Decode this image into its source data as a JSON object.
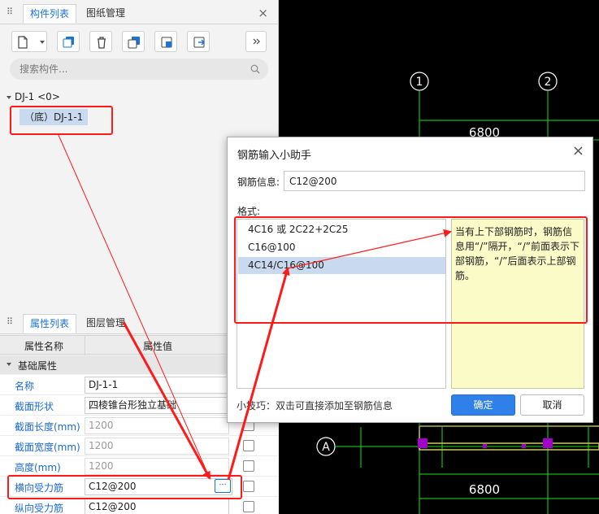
{
  "components_panel": {
    "tabs": [
      "构件列表",
      "图纸管理"
    ],
    "close_icon": "×",
    "toolbar_icons": [
      "new-icon",
      "copy-icon",
      "delete-icon",
      "duplicate-icon",
      "layer-copy-icon",
      "export-icon",
      "expand-icon"
    ],
    "search_placeholder": "搜索构件...",
    "tree": {
      "root_label": "DJ-1  <0>",
      "child_label": "（底）DJ-1-1"
    }
  },
  "properties_panel": {
    "tabs": [
      "属性列表",
      "图层管理"
    ],
    "col_name": "属性名称",
    "col_value": "属性值",
    "group_label": "基础属性",
    "rows": [
      {
        "name": "名称",
        "value": "DJ-1-1",
        "dim": false,
        "checkbox": false
      },
      {
        "name": "截面形状",
        "value": "四棱锥台形独立基础",
        "dim": false,
        "checkbox": false
      },
      {
        "name": "截面长度(mm)",
        "value": "1200",
        "dim": true,
        "checkbox": true
      },
      {
        "name": "截面宽度(mm)",
        "value": "1200",
        "dim": true,
        "checkbox": true
      },
      {
        "name": "高度(mm)",
        "value": "1200",
        "dim": true,
        "checkbox": true
      },
      {
        "name": "横向受力筋",
        "value": "C12@200",
        "dim": false,
        "checkbox": true,
        "more": "···"
      },
      {
        "name": "纵向受力筋",
        "value": "C12@200",
        "dim": false,
        "checkbox": true
      }
    ]
  },
  "cad": {
    "axis_labels": [
      "1",
      "2",
      "A"
    ],
    "dimension_top": "6800",
    "dimension_bottom": "6800",
    "line_color": "#19e619",
    "beam_color": "#c9c95a",
    "column_color": "#a000c8"
  },
  "dialog": {
    "title": "钢筋输入小助手",
    "close_icon": "×",
    "info_label": "钢筋信息:",
    "info_value": "C12@200",
    "format_label": "格式:",
    "formats": [
      "4C16 或 2C22+2C25",
      "C16@100",
      "4C14/C16@100"
    ],
    "selected_index": 2,
    "note": "当有上下部钢筋时，钢筋信息用“/”隔开，“/”前面表示下部钢筋，“/”后面表示上部钢筋。",
    "tip": "小技巧：双击可直接添加至钢筋信息",
    "ok_label": "确定",
    "cancel_label": "取消"
  },
  "annotation_color": "#ff1a1a"
}
